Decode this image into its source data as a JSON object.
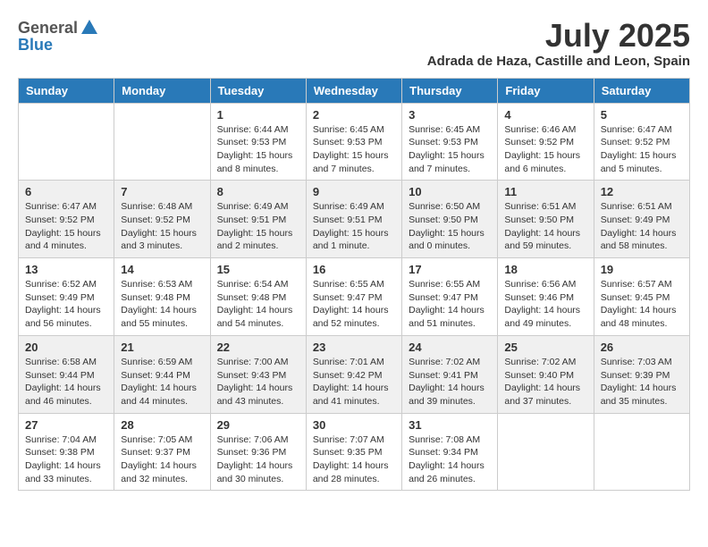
{
  "logo": {
    "text_general": "General",
    "text_blue": "Blue"
  },
  "title": {
    "month": "July 2025",
    "location": "Adrada de Haza, Castille and Leon, Spain"
  },
  "weekdays": [
    "Sunday",
    "Monday",
    "Tuesday",
    "Wednesday",
    "Thursday",
    "Friday",
    "Saturday"
  ],
  "weeks": [
    [
      {
        "day": "",
        "sunrise": "",
        "sunset": "",
        "daylight": ""
      },
      {
        "day": "",
        "sunrise": "",
        "sunset": "",
        "daylight": ""
      },
      {
        "day": "1",
        "sunrise": "Sunrise: 6:44 AM",
        "sunset": "Sunset: 9:53 PM",
        "daylight": "Daylight: 15 hours and 8 minutes."
      },
      {
        "day": "2",
        "sunrise": "Sunrise: 6:45 AM",
        "sunset": "Sunset: 9:53 PM",
        "daylight": "Daylight: 15 hours and 7 minutes."
      },
      {
        "day": "3",
        "sunrise": "Sunrise: 6:45 AM",
        "sunset": "Sunset: 9:53 PM",
        "daylight": "Daylight: 15 hours and 7 minutes."
      },
      {
        "day": "4",
        "sunrise": "Sunrise: 6:46 AM",
        "sunset": "Sunset: 9:52 PM",
        "daylight": "Daylight: 15 hours and 6 minutes."
      },
      {
        "day": "5",
        "sunrise": "Sunrise: 6:47 AM",
        "sunset": "Sunset: 9:52 PM",
        "daylight": "Daylight: 15 hours and 5 minutes."
      }
    ],
    [
      {
        "day": "6",
        "sunrise": "Sunrise: 6:47 AM",
        "sunset": "Sunset: 9:52 PM",
        "daylight": "Daylight: 15 hours and 4 minutes."
      },
      {
        "day": "7",
        "sunrise": "Sunrise: 6:48 AM",
        "sunset": "Sunset: 9:52 PM",
        "daylight": "Daylight: 15 hours and 3 minutes."
      },
      {
        "day": "8",
        "sunrise": "Sunrise: 6:49 AM",
        "sunset": "Sunset: 9:51 PM",
        "daylight": "Daylight: 15 hours and 2 minutes."
      },
      {
        "day": "9",
        "sunrise": "Sunrise: 6:49 AM",
        "sunset": "Sunset: 9:51 PM",
        "daylight": "Daylight: 15 hours and 1 minute."
      },
      {
        "day": "10",
        "sunrise": "Sunrise: 6:50 AM",
        "sunset": "Sunset: 9:50 PM",
        "daylight": "Daylight: 15 hours and 0 minutes."
      },
      {
        "day": "11",
        "sunrise": "Sunrise: 6:51 AM",
        "sunset": "Sunset: 9:50 PM",
        "daylight": "Daylight: 14 hours and 59 minutes."
      },
      {
        "day": "12",
        "sunrise": "Sunrise: 6:51 AM",
        "sunset": "Sunset: 9:49 PM",
        "daylight": "Daylight: 14 hours and 58 minutes."
      }
    ],
    [
      {
        "day": "13",
        "sunrise": "Sunrise: 6:52 AM",
        "sunset": "Sunset: 9:49 PM",
        "daylight": "Daylight: 14 hours and 56 minutes."
      },
      {
        "day": "14",
        "sunrise": "Sunrise: 6:53 AM",
        "sunset": "Sunset: 9:48 PM",
        "daylight": "Daylight: 14 hours and 55 minutes."
      },
      {
        "day": "15",
        "sunrise": "Sunrise: 6:54 AM",
        "sunset": "Sunset: 9:48 PM",
        "daylight": "Daylight: 14 hours and 54 minutes."
      },
      {
        "day": "16",
        "sunrise": "Sunrise: 6:55 AM",
        "sunset": "Sunset: 9:47 PM",
        "daylight": "Daylight: 14 hours and 52 minutes."
      },
      {
        "day": "17",
        "sunrise": "Sunrise: 6:55 AM",
        "sunset": "Sunset: 9:47 PM",
        "daylight": "Daylight: 14 hours and 51 minutes."
      },
      {
        "day": "18",
        "sunrise": "Sunrise: 6:56 AM",
        "sunset": "Sunset: 9:46 PM",
        "daylight": "Daylight: 14 hours and 49 minutes."
      },
      {
        "day": "19",
        "sunrise": "Sunrise: 6:57 AM",
        "sunset": "Sunset: 9:45 PM",
        "daylight": "Daylight: 14 hours and 48 minutes."
      }
    ],
    [
      {
        "day": "20",
        "sunrise": "Sunrise: 6:58 AM",
        "sunset": "Sunset: 9:44 PM",
        "daylight": "Daylight: 14 hours and 46 minutes."
      },
      {
        "day": "21",
        "sunrise": "Sunrise: 6:59 AM",
        "sunset": "Sunset: 9:44 PM",
        "daylight": "Daylight: 14 hours and 44 minutes."
      },
      {
        "day": "22",
        "sunrise": "Sunrise: 7:00 AM",
        "sunset": "Sunset: 9:43 PM",
        "daylight": "Daylight: 14 hours and 43 minutes."
      },
      {
        "day": "23",
        "sunrise": "Sunrise: 7:01 AM",
        "sunset": "Sunset: 9:42 PM",
        "daylight": "Daylight: 14 hours and 41 minutes."
      },
      {
        "day": "24",
        "sunrise": "Sunrise: 7:02 AM",
        "sunset": "Sunset: 9:41 PM",
        "daylight": "Daylight: 14 hours and 39 minutes."
      },
      {
        "day": "25",
        "sunrise": "Sunrise: 7:02 AM",
        "sunset": "Sunset: 9:40 PM",
        "daylight": "Daylight: 14 hours and 37 minutes."
      },
      {
        "day": "26",
        "sunrise": "Sunrise: 7:03 AM",
        "sunset": "Sunset: 9:39 PM",
        "daylight": "Daylight: 14 hours and 35 minutes."
      }
    ],
    [
      {
        "day": "27",
        "sunrise": "Sunrise: 7:04 AM",
        "sunset": "Sunset: 9:38 PM",
        "daylight": "Daylight: 14 hours and 33 minutes."
      },
      {
        "day": "28",
        "sunrise": "Sunrise: 7:05 AM",
        "sunset": "Sunset: 9:37 PM",
        "daylight": "Daylight: 14 hours and 32 minutes."
      },
      {
        "day": "29",
        "sunrise": "Sunrise: 7:06 AM",
        "sunset": "Sunset: 9:36 PM",
        "daylight": "Daylight: 14 hours and 30 minutes."
      },
      {
        "day": "30",
        "sunrise": "Sunrise: 7:07 AM",
        "sunset": "Sunset: 9:35 PM",
        "daylight": "Daylight: 14 hours and 28 minutes."
      },
      {
        "day": "31",
        "sunrise": "Sunrise: 7:08 AM",
        "sunset": "Sunset: 9:34 PM",
        "daylight": "Daylight: 14 hours and 26 minutes."
      },
      {
        "day": "",
        "sunrise": "",
        "sunset": "",
        "daylight": ""
      },
      {
        "day": "",
        "sunrise": "",
        "sunset": "",
        "daylight": ""
      }
    ]
  ]
}
